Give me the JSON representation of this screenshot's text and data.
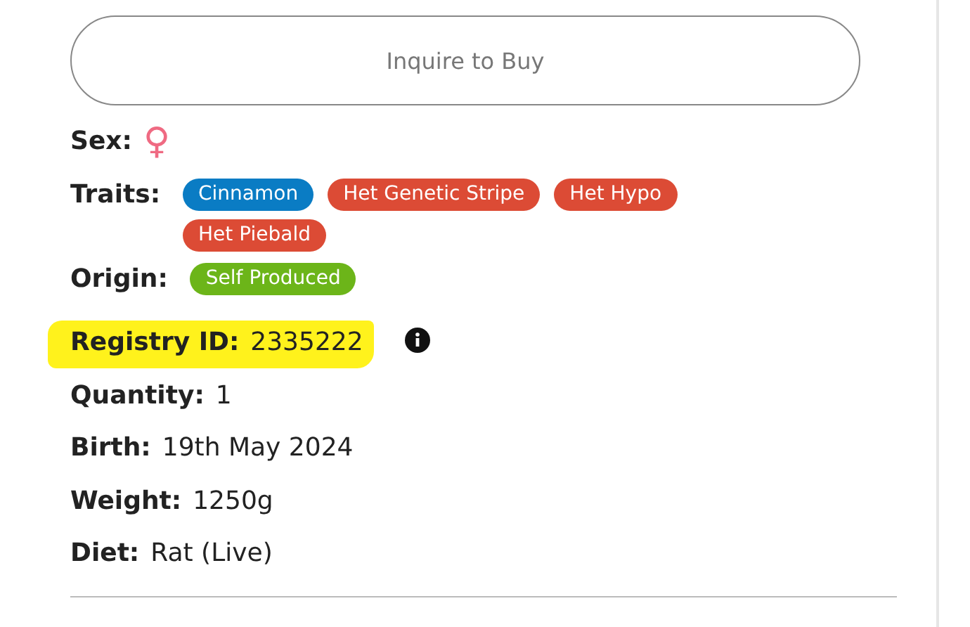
{
  "button": {
    "label": "Inquire to Buy"
  },
  "fields": [
    {
      "kind": "sex",
      "label": "Sex:",
      "value": "♀"
    },
    {
      "kind": "tags",
      "label": "Traits:",
      "tags": [
        {
          "text": "Cinnamon",
          "color": "#0a7cc4"
        },
        {
          "text": "Het Genetic Stripe",
          "color": "#dc4b35"
        },
        {
          "text": "Het Hypo",
          "color": "#dc4b35"
        },
        {
          "text": "Het Piebald",
          "color": "#dc4b35"
        }
      ]
    },
    {
      "kind": "tags",
      "label": "Origin:",
      "tags": [
        {
          "text": "Self Produced",
          "color": "#6cb519"
        }
      ]
    },
    {
      "kind": "highlighted",
      "label": "Registry ID:",
      "value": "2335222"
    },
    {
      "kind": "text",
      "label": "Quantity:",
      "value": "1"
    },
    {
      "kind": "text",
      "label": "Birth:",
      "value": "19th May 2024"
    },
    {
      "kind": "text",
      "label": "Weight:",
      "value": "1250g"
    },
    {
      "kind": "text",
      "label": "Diet:",
      "value": "Rat (Live)"
    }
  ]
}
